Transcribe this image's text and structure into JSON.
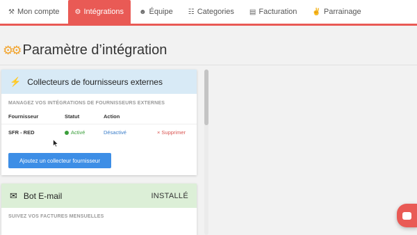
{
  "tabs": [
    {
      "label": "Mon compte",
      "icon": "wrench-icon",
      "glyph": "⚒",
      "active": false
    },
    {
      "label": "Intégrations",
      "icon": "gear-icon",
      "glyph": "⚙",
      "active": true
    },
    {
      "label": "Équipe",
      "icon": "users-icon",
      "glyph": "☻",
      "active": false
    },
    {
      "label": "Categories",
      "icon": "sitemap-icon",
      "glyph": "☷",
      "active": false
    },
    {
      "label": "Facturation",
      "icon": "file-icon",
      "glyph": "▤",
      "active": false
    },
    {
      "label": "Parrainage",
      "icon": "thumbs-up-icon",
      "glyph": "✌",
      "active": false
    }
  ],
  "page": {
    "title": "Paramètre d’intégration",
    "icon": "gears-icon",
    "glyph": "⚙⚙"
  },
  "collectors": {
    "title": "Collecteurs de fournisseurs externes",
    "icon": "plug-icon",
    "glyph": "⚡",
    "subtitle": "MANAGEZ VOS INTÉGRATIONS DE FOURNISSEURS EXTERNES",
    "columns": {
      "provider": "Fournisseur",
      "status": "Statut",
      "action": "Action"
    },
    "rows": [
      {
        "provider": "SFR - RED",
        "status": "Activé",
        "action": "Désactivé",
        "delete": "× Supprimer"
      }
    ],
    "add_button": "Ajoutez un collecteur fournisseur"
  },
  "email_bot": {
    "title": "Bot E-mail",
    "icon": "envelope-icon",
    "glyph": "✉",
    "badge": "INSTALLÉ",
    "subtitle": "SUIVEZ VOS FACTURES MENSUELLES"
  },
  "colors": {
    "accent": "#e95a55",
    "panel_blue": "#d8eaf6",
    "panel_green": "#dcefd7",
    "button_blue": "#3d8ee6",
    "status_green": "#3a9e3a",
    "link_blue": "#3a7dc9",
    "delete_red": "#d9534f"
  }
}
